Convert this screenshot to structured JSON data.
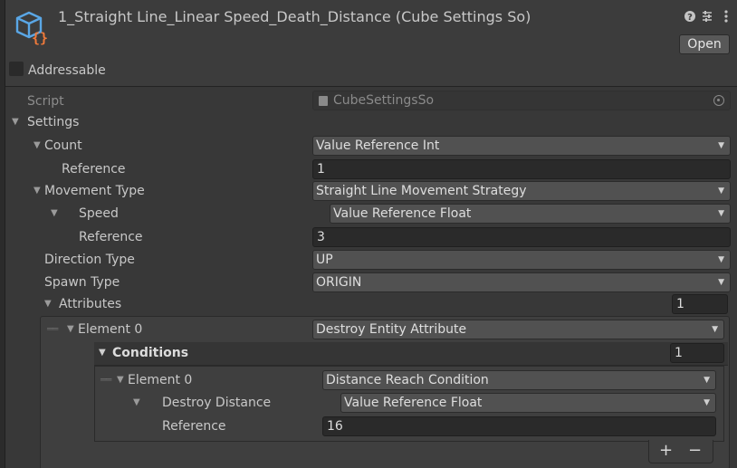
{
  "header": {
    "title": "1_Straight Line_Linear Speed_Death_Distance (Cube Settings So)",
    "open_label": "Open",
    "addressable_label": "Addressable"
  },
  "script": {
    "label": "Script",
    "value": "CubeSettingsSo"
  },
  "settings": {
    "label": "Settings",
    "count": {
      "label": "Count",
      "value": "Value Reference Int",
      "reference_label": "Reference",
      "reference_value": "1"
    },
    "movement_type": {
      "label": "Movement Type",
      "value": "Straight Line Movement Strategy",
      "speed_label": "Speed",
      "speed_value": "Value Reference Float",
      "reference_label": "Reference",
      "reference_value": "3"
    },
    "direction_type": {
      "label": "Direction Type",
      "value": "UP"
    },
    "spawn_type": {
      "label": "Spawn Type",
      "value": "ORIGIN"
    },
    "attributes": {
      "label": "Attributes",
      "size": "1",
      "element": {
        "label": "Element 0",
        "value": "Destroy Entity Attribute",
        "conditions": {
          "label": "Conditions",
          "size": "1",
          "element": {
            "label": "Element 0",
            "value": "Distance Reach Condition",
            "destroy_distance_label": "Destroy Distance",
            "destroy_distance_value": "Value Reference Float",
            "reference_label": "Reference",
            "reference_value": "16"
          }
        }
      }
    }
  },
  "list_controls": {
    "add": "+",
    "remove": "−"
  }
}
